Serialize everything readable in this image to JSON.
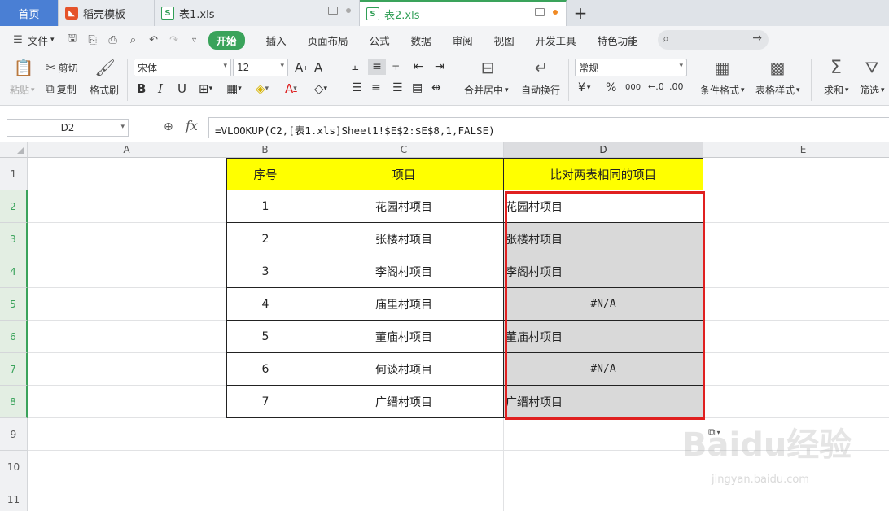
{
  "tabs": {
    "home": "首页",
    "docer": "稻壳模板",
    "file1": "表1.xls",
    "file2": "表2.xls",
    "new_tab": "+"
  },
  "menu": {
    "file": "文件",
    "start": "开始",
    "items": [
      "插入",
      "页面布局",
      "公式",
      "数据",
      "审阅",
      "视图",
      "开发工具",
      "特色功能"
    ]
  },
  "ribbon": {
    "paste": "粘贴",
    "cut": "剪切",
    "copy": "复制",
    "format_painter": "格式刷",
    "font_name": "宋体",
    "font_size": "12",
    "bold": "B",
    "italic": "I",
    "underline": "U",
    "merge_center": "合并居中",
    "wrap_text": "自动换行",
    "number_format": "常规",
    "currency": "¥",
    "percent": "%",
    "thousands": "000",
    "cond_format": "条件格式",
    "table_style": "表格样式",
    "sum": "求和",
    "filter": "筛选"
  },
  "formula_bar": {
    "name_box": "D2",
    "fx": "fx",
    "formula": "=VLOOKUP(C2,[表1.xls]Sheet1!$E$2:$E$8,1,FALSE)"
  },
  "columns": [
    "A",
    "B",
    "C",
    "D",
    "E"
  ],
  "rows": [
    "1",
    "2",
    "3",
    "4",
    "5",
    "6",
    "7",
    "8",
    "9",
    "10",
    "11"
  ],
  "table": {
    "headers": [
      "序号",
      "项目",
      "比对两表相同的项目"
    ],
    "rows": [
      {
        "no": "1",
        "item": "花园村项目",
        "match": "花园村项目"
      },
      {
        "no": "2",
        "item": "张楼村项目",
        "match": "张楼村项目"
      },
      {
        "no": "3",
        "item": "李阁村项目",
        "match": "李阁村项目"
      },
      {
        "no": "4",
        "item": "庙里村项目",
        "match": "#N/A"
      },
      {
        "no": "5",
        "item": "董庙村项目",
        "match": "董庙村项目"
      },
      {
        "no": "6",
        "item": "何谈村项目",
        "match": "#N/A"
      },
      {
        "no": "7",
        "item": "广缙村项目",
        "match": "广缙村项目"
      }
    ]
  },
  "watermark": {
    "brand": "Baidu经验",
    "url": "jingyan.baidu.com"
  },
  "colors": {
    "header_fill": "#ffff00",
    "selection_border": "#e02020",
    "accent": "#3aa35b"
  }
}
